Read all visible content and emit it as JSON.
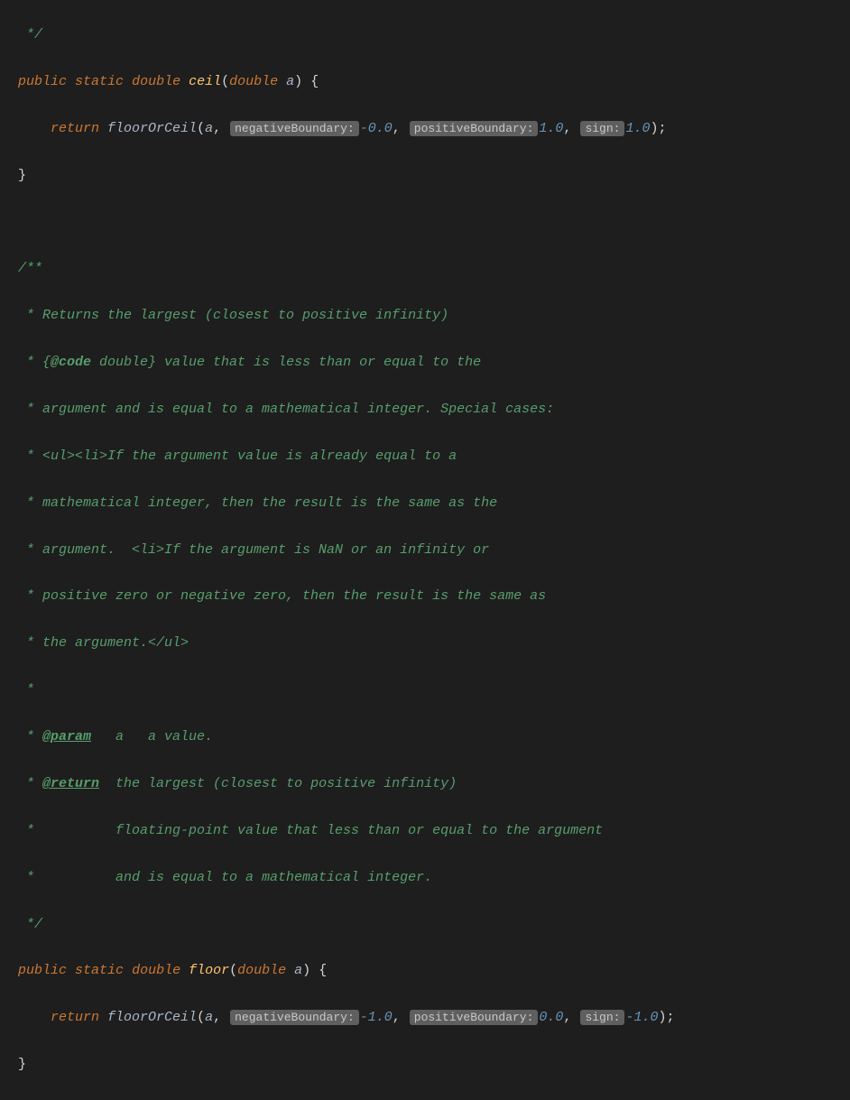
{
  "code": {
    "line1": " */",
    "line2": {
      "public": "public",
      "static": "static",
      "double": "double",
      "name": "ceil",
      "paramType": "double",
      "paramName": "a",
      "brace": "{"
    },
    "line3": {
      "return": "return",
      "call": "floorOrCeil",
      "arg1": "a",
      "hint1": "negativeBoundary:",
      "val1": "-0.0",
      "hint2": "positiveBoundary:",
      "val2": "1.0",
      "hint3": "sign:",
      "val3": "1.0"
    },
    "line4": "}",
    "line6": "/**",
    "line7": " * Returns the largest (closest to positive infinity)",
    "line8a": " * {",
    "line8tag": "@code",
    "line8b": " double} value that is less than or equal to the",
    "line9": " * argument and is equal to a mathematical integer. Special cases:",
    "line10": " * <ul><li>If the argument value is already equal to a",
    "line11": " * mathematical integer, then the result is the same as the",
    "line12": " * argument.  <li>If the argument is NaN or an infinity or",
    "line13": " * positive zero or negative zero, then the result is the same as",
    "line14": " * the argument.</ul>",
    "line15": " *",
    "line16a": " * ",
    "line16tag": "@param",
    "line16b": "   a   a value.",
    "line17a": " * ",
    "line17tag": "@return",
    "line17b": "  the largest (closest to positive infinity)",
    "line18": " *          floating-point value that less than or equal to the argument",
    "line19": " *          and is equal to a mathematical integer.",
    "line20": " */",
    "line21": {
      "public": "public",
      "static": "static",
      "double": "double",
      "name": "floor",
      "paramType": "double",
      "paramName": "a",
      "brace": "{"
    },
    "line22": {
      "return": "return",
      "call": "floorOrCeil",
      "arg1": "a",
      "hint1": "negativeBoundary:",
      "val1": "-1.0",
      "hint2": "positiveBoundary:",
      "val2": "0.0",
      "hint3": "sign:",
      "val3": "-1.0"
    },
    "line23": "}"
  }
}
